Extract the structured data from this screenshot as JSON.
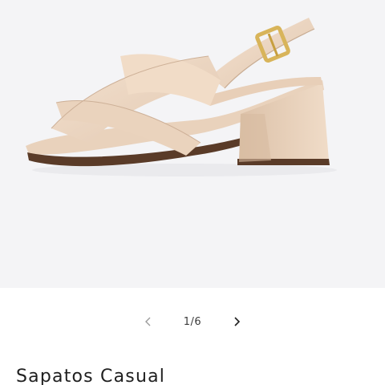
{
  "product": {
    "title": "Sapatos Casual",
    "image_alt": "nude leather block-heel sandal with crossed straps and gold buckle"
  },
  "gallery": {
    "current_index": 1,
    "total": 6,
    "counter_label": "1/6",
    "prev_icon": "chevron-left-icon",
    "next_icon": "chevron-right-icon"
  },
  "colors": {
    "media_background": "#f4f4f6",
    "leather": "#ecd7c3",
    "sole": "#5a3b28",
    "buckle": "#d8b45a",
    "text": "#1f1f1f",
    "chevron": "#9a9a9a"
  }
}
